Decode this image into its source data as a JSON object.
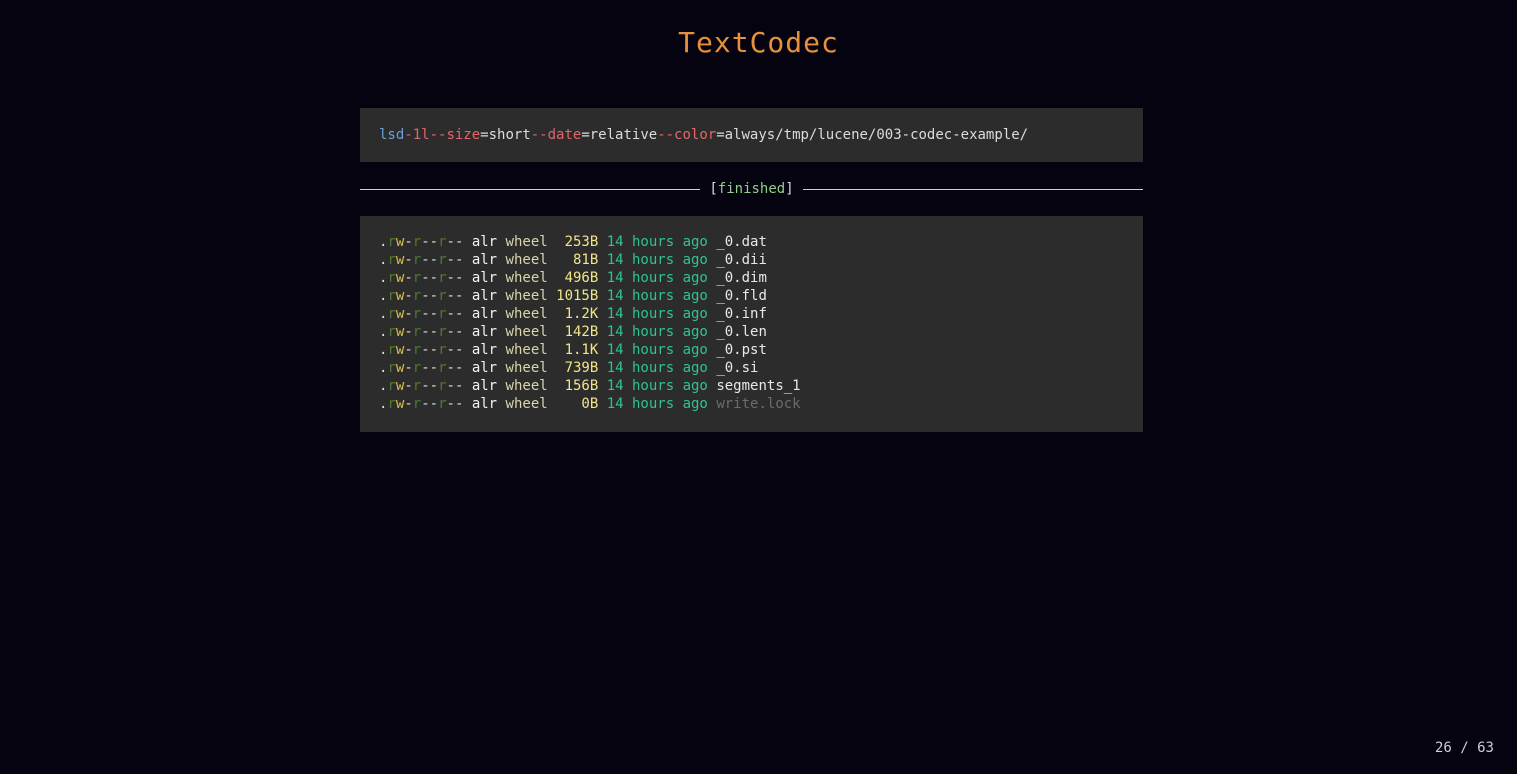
{
  "title": "TextCodec",
  "command": {
    "bin": "lsd",
    "flag_1l": "-1l",
    "flag_size": "--size",
    "size_val": "=short",
    "flag_date": "--date",
    "date_val": "=relative",
    "flag_color": "--color",
    "color_val": "=always",
    "path": "/tmp/lucene/003-codec-example/"
  },
  "status": {
    "open": "[",
    "word": "finished",
    "close": "]"
  },
  "listing": [
    {
      "perm_dot": ".",
      "perm_r": "r",
      "perm_w": "w",
      "perm_rest": "-r--r--",
      "user": "alr",
      "group": "wheel",
      "size": "253B",
      "date": "14 hours ago",
      "name": "_0.dat"
    },
    {
      "perm_dot": ".",
      "perm_r": "r",
      "perm_w": "w",
      "perm_rest": "-r--r--",
      "user": "alr",
      "group": "wheel",
      "size": "81B",
      "date": "14 hours ago",
      "name": "_0.dii"
    },
    {
      "perm_dot": ".",
      "perm_r": "r",
      "perm_w": "w",
      "perm_rest": "-r--r--",
      "user": "alr",
      "group": "wheel",
      "size": "496B",
      "date": "14 hours ago",
      "name": "_0.dim"
    },
    {
      "perm_dot": ".",
      "perm_r": "r",
      "perm_w": "w",
      "perm_rest": "-r--r--",
      "user": "alr",
      "group": "wheel",
      "size": "1015B",
      "date": "14 hours ago",
      "name": "_0.fld"
    },
    {
      "perm_dot": ".",
      "perm_r": "r",
      "perm_w": "w",
      "perm_rest": "-r--r--",
      "user": "alr",
      "group": "wheel",
      "size": "1.2K",
      "date": "14 hours ago",
      "name": "_0.inf"
    },
    {
      "perm_dot": ".",
      "perm_r": "r",
      "perm_w": "w",
      "perm_rest": "-r--r--",
      "user": "alr",
      "group": "wheel",
      "size": "142B",
      "date": "14 hours ago",
      "name": "_0.len"
    },
    {
      "perm_dot": ".",
      "perm_r": "r",
      "perm_w": "w",
      "perm_rest": "-r--r--",
      "user": "alr",
      "group": "wheel",
      "size": "1.1K",
      "date": "14 hours ago",
      "name": "_0.pst"
    },
    {
      "perm_dot": ".",
      "perm_r": "r",
      "perm_w": "w",
      "perm_rest": "-r--r--",
      "user": "alr",
      "group": "wheel",
      "size": "739B",
      "date": "14 hours ago",
      "name": "_0.si"
    },
    {
      "perm_dot": ".",
      "perm_r": "r",
      "perm_w": "w",
      "perm_rest": "-r--r--",
      "user": "alr",
      "group": "wheel",
      "size": "156B",
      "date": "14 hours ago",
      "name": "segments_1"
    },
    {
      "perm_dot": ".",
      "perm_r": "r",
      "perm_w": "w",
      "perm_rest": "-r--r--",
      "user": "alr",
      "group": "wheel",
      "size": "0B",
      "date": "14 hours ago",
      "name": "write.lock",
      "dim": true
    }
  ],
  "pager": "26 / 63",
  "colors": {
    "background": "#04030f",
    "title": "#e8903c",
    "panel": "#2c2c2c",
    "command": "#6ea0d8",
    "flag": "#e2676a",
    "finished": "#8fd18c",
    "size": "#f2e58a",
    "date": "#2fc48f"
  }
}
